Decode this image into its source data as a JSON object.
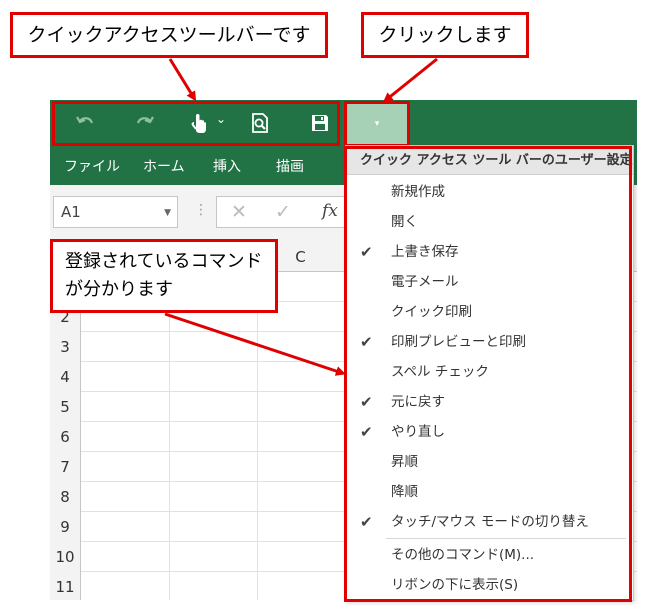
{
  "callouts": {
    "qat": "クイックアクセスツールバーです",
    "click": "クリックします",
    "commands": "登録されているコマンド\nが分かります"
  },
  "qat": {
    "icons": [
      "undo-icon",
      "redo-icon",
      "touch-mouse-mode-icon",
      "print-preview-icon",
      "save-icon",
      "customize-qat-dropdown-icon"
    ],
    "touch_caret": "⌄",
    "dropdown_glyph": "▾"
  },
  "ribbon": {
    "tabs": [
      "ファイル",
      "ホーム",
      "挿入",
      "描画"
    ]
  },
  "formula_bar": {
    "name_box": "A1",
    "fx": "fx"
  },
  "grid": {
    "columns": [
      "",
      "C"
    ],
    "rows": [
      "",
      "2",
      "3",
      "4",
      "5",
      "6",
      "7",
      "8",
      "9",
      "10",
      "11"
    ]
  },
  "menu": {
    "header": "クイック アクセス ツール バーのユーザー設定",
    "items": [
      {
        "label": "新規作成",
        "checked": false
      },
      {
        "label": "開く",
        "checked": false
      },
      {
        "label": "上書き保存",
        "checked": true
      },
      {
        "label": "電子メール",
        "checked": false
      },
      {
        "label": "クイック印刷",
        "checked": false
      },
      {
        "label": "印刷プレビューと印刷",
        "checked": true
      },
      {
        "label": "スペル チェック",
        "checked": false
      },
      {
        "label": "元に戻す",
        "checked": true
      },
      {
        "label": "やり直し",
        "checked": true
      },
      {
        "label": "昇順",
        "checked": false
      },
      {
        "label": "降順",
        "checked": false
      },
      {
        "label": "タッチ/マウス モードの切り替え",
        "checked": true
      }
    ],
    "more_commands": "その他のコマンド(M)...",
    "show_below": "リボンの下に表示(S)",
    "check_glyph": "✔"
  },
  "colors": {
    "excel_green": "#217346",
    "highlight_red": "#e00000",
    "dropdown_active": "#a6d1b7"
  }
}
